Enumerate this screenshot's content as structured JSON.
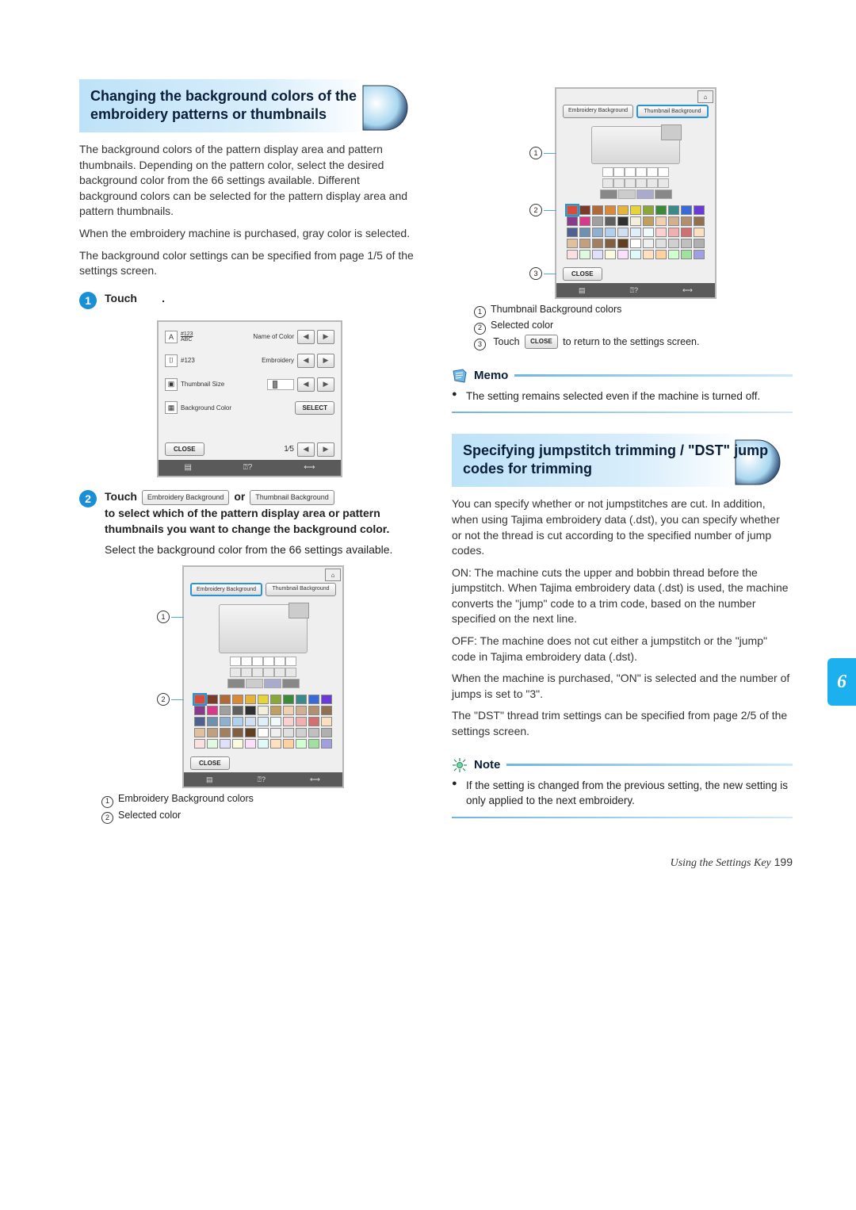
{
  "section1": {
    "heading": "Changing the background colors of the embroidery patterns or thumbnails",
    "para1": "The background colors of the pattern display area and pattern thumbnails. Depending on the pattern color, select the desired background color from the 66 settings available. Different background colors can be selected for the pattern display area and pattern thumbnails.",
    "para2": "When the embroidery machine is purchased, gray color is selected.",
    "para3": "The background color settings can be specified from page 1/5 of the settings screen.",
    "step1": {
      "num": "1",
      "textPrefix": "Touch",
      "textSuffix": "."
    },
    "screen1": {
      "row1Label": "#123\nABC",
      "row1Right": "Name of Color",
      "row2Label": "#123",
      "row2Right": "Embroidery",
      "row3Label": "Thumbnail Size",
      "row4Label": "Background Color",
      "selectBtn": "SELECT",
      "closeBtn": "CLOSE",
      "pageIndicator": "1∕5"
    },
    "step2": {
      "num": "2",
      "touchWord": "Touch",
      "btn1": "Embroidery Background",
      "orWord": "or",
      "btn2": "Thumbnail Background",
      "boldLine": "to select which of the pattern display area or pattern thumbnails you want to change the background color.",
      "nextLine": "Select the background color from the 66 settings available."
    },
    "screen2": {
      "tabEmb": "Embroidery Background",
      "tabTh": "Thumbnail Background",
      "close": "CLOSE"
    },
    "legend2": {
      "l1": "Embroidery Background colors",
      "l2": "Selected color"
    }
  },
  "rightTop": {
    "screen3": {
      "tabEmb": "Embroidery Background",
      "tabTh": "Thumbnail Background",
      "close": "CLOSE"
    },
    "legend3": {
      "l1": "Thumbnail Background colors",
      "l2": "Selected color",
      "l3Prefix": "Touch",
      "l3Btn": "CLOSE",
      "l3Suffix": "to return to the settings screen."
    },
    "memo": {
      "title": "Memo",
      "body": "The setting remains selected even if the machine is turned off."
    }
  },
  "section2": {
    "heading": "Specifying jumpstitch trimming / \"DST\" jump codes for trimming",
    "para1": "You can specify whether or not jumpstitches are cut. In addition, when using Tajima embroidery data (.dst), you can specify whether or not the thread is cut according to the specified number of jump codes.",
    "para2": "ON: The machine cuts the upper and bobbin thread before the jumpstitch. When Tajima embroidery data (.dst) is used, the machine converts the \"jump\" code to a trim code, based on the number specified on the next line.",
    "para3": "OFF: The machine does not cut either a jumpstitch or the \"jump\" code in Tajima embroidery data (.dst).",
    "para4": "When the machine is purchased, \"ON\" is selected and the number of jumps is set to \"3\".",
    "para5": "The \"DST\" thread trim settings can be specified from page 2/5 of the settings screen.",
    "note": {
      "title": "Note",
      "body": "If the setting is changed from the previous setting, the new setting is only applied to the next embroidery."
    }
  },
  "sideTab": "6",
  "footer": {
    "label": "Using the Settings Key",
    "page": "199"
  },
  "swatchColors": [
    "#d94b3a",
    "#7a3b2a",
    "#b06a3a",
    "#d88a3a",
    "#e5b43a",
    "#e5d43a",
    "#8aa83a",
    "#3a8a3a",
    "#3a8a8a",
    "#3a6ad8",
    "#6a3ad8",
    "#8a3a8a",
    "#d83a8a",
    "#a0a0a0",
    "#606060",
    "#303030",
    "#f4eedc",
    "#c0a060",
    "#f0d0b0",
    "#d0b090",
    "#b09070",
    "#907050",
    "#506090",
    "#7090b0",
    "#90b0d0",
    "#b0d0f0",
    "#d0e0f0",
    "#e0f0fa",
    "#f0fafa",
    "#fad0d0",
    "#f0b0b0",
    "#d07070",
    "#fae0c0",
    "#e0c0a0",
    "#c0a080",
    "#a08060",
    "#806040",
    "#604020",
    "#ffffff",
    "#f0f0f0",
    "#e0e0e0",
    "#d0d0d0",
    "#c0c0c0",
    "#b0b0b0",
    "#fae0e0",
    "#e0fae0",
    "#e0e0fa",
    "#fafae0",
    "#fae0fa",
    "#e0fafa",
    "#ffe0c0",
    "#ffd0a0",
    "#d0ffd0",
    "#a0e0a0",
    "#a0a0e0",
    "#e0a0e0",
    "#404080",
    "#804040",
    "#408040",
    "#808040",
    "#804080",
    "#408080",
    "#202040",
    "#402020",
    "#204020",
    "#404020"
  ]
}
